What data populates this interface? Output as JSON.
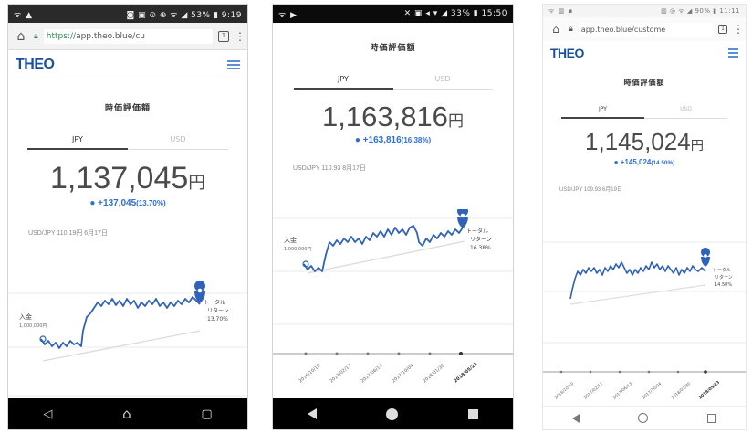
{
  "phones": [
    {
      "status": {
        "left": "ᯤ ▲",
        "right": "◙ ▣ ⊙ ⊕ ᯤ ◢ 53% ▮ 9:19"
      },
      "browser": {
        "url_secure": "https://",
        "url_rest": "app.theo.blue/cu"
      },
      "app": {
        "logo": "THEO"
      },
      "title": "時価評価額",
      "tabs": [
        "JPY",
        "USD"
      ],
      "amount": "1,137,045",
      "unit": "円",
      "change": "+137,045",
      "change_pct": "(13.70%)",
      "rate": "USD/JPY 110.19円 6月17日",
      "chart_labels": {
        "start": "入金",
        "start_sub": "1,000,000円",
        "end": "トータル",
        "end_sub1": "リターン",
        "end_sub2": "13.70%"
      }
    },
    {
      "status": {
        "left": "ᯤ ▶",
        "right": "✕ ▣ ◂ ▾ ◢ 33% ▮ 15:50"
      },
      "title": "時価評価額",
      "tabs": [
        "JPY",
        "USD"
      ],
      "amount": "1,163,816",
      "unit": "円",
      "change": "+163,816",
      "change_pct": "(16.38%)",
      "rate": "USD/JPY 110.93 8月17日",
      "chart_labels": {
        "start": "入金",
        "start_sub": "1,000,000円",
        "end": "トータル",
        "end_sub1": "リターン",
        "end_sub2": "16.38%"
      },
      "x_dates": [
        "2016/10/10",
        "2017/02/17",
        "2017/06/13",
        "2017/10/04",
        "2018/01/30",
        "2018/05/23"
      ]
    },
    {
      "status": {
        "left": "ᯤ ▥ ▪",
        "right": "▥ ◎ ᯤ ◢ 90% ▮ 11:11"
      },
      "browser": {
        "url_secure": "",
        "url_rest": "app.theo.blue/custome"
      },
      "app": {
        "logo": "THEO"
      },
      "title": "時価評価額",
      "tabs": [
        "JPY",
        "USD"
      ],
      "amount": "1,145,024",
      "unit": "円",
      "change": "+145,024",
      "change_pct": "(14.50%)",
      "rate": "USD/JPY 109.93 6月19日",
      "chart_labels": {
        "end": "トータル",
        "end_sub1": "リターン",
        "end_sub2": "14.50%"
      },
      "x_dates": [
        "2016/10/10",
        "2017/02/17",
        "2017/06/13",
        "2017/10/04",
        "2018/01/30",
        "2018/05/23"
      ]
    }
  ],
  "colors": {
    "brand": "#1b4f9c",
    "line": "#2f62b8",
    "change": "#2f6fcf",
    "baseline": "#d8d8d8"
  }
}
